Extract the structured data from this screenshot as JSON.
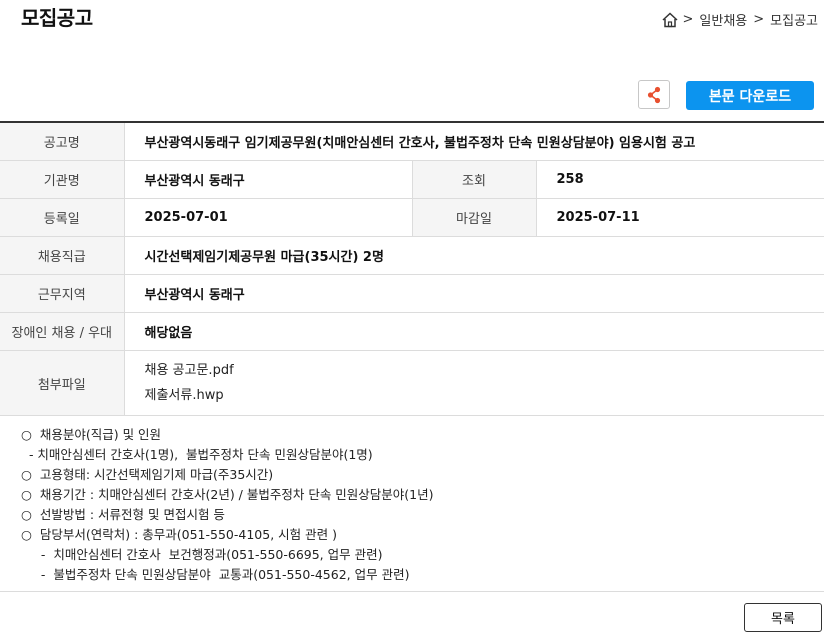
{
  "header": {
    "title": "모집공고",
    "breadcrumb": [
      {
        "label": ">"
      },
      {
        "label": "일반채용"
      },
      {
        "label": ">"
      },
      {
        "label": "모집공고"
      }
    ]
  },
  "actions": {
    "share_icon": "share-icon",
    "download_label": "본문 다운로드"
  },
  "colors": {
    "accent": "#0c94ef",
    "share_icon": "#e8502f"
  },
  "info": {
    "title_label": "공고명",
    "title_value": "부산광역시동래구 임기제공무원(치매안심센터 간호사, 불법주정차 단속 민원상담분야) 임용시험 공고",
    "org_label": "기관명",
    "org_value": "부산광역시 동래구",
    "views_label": "조회",
    "views_value": "258",
    "reg_label": "등록일",
    "reg_value": "2025-07-01",
    "deadline_label": "마감일",
    "deadline_value": "2025-07-11",
    "rank_label": "채용직급",
    "rank_value": "시간선택제임기제공무원 마급(35시간) 2명",
    "region_label": "근무지역",
    "region_value": "부산광역시 동래구",
    "disabled_label": "장애인 채용 / 우대",
    "disabled_value": "해당없음",
    "files_label": "첨부파일",
    "files": [
      "채용 공고문.pdf",
      "제출서류.hwp"
    ]
  },
  "content": {
    "lines": [
      "○  채용분야(직급) 및 인원",
      "  - 치매안심센터 간호사(1명),  불법주정차 단속 민원상담분야(1명)",
      "○  고용형태: 시간선택제임기제 마급(주35시간)",
      "○  채용기간 : 치매안심센터 간호사(2년) / 불법주정차 단속 민원상담분야(1년)",
      "○  선발방법 : 서류전형 및 면접시험 등",
      "○  담당부서(연락처) : 총무과(051-550-4105, 시험 관련 )",
      "     -  치매안심센터 간호사  보건행정과(051-550-6695, 업무 관련)",
      "     -  불법주정차 단속 민원상담분야  교통과(051-550-4562, 업무 관련)"
    ]
  },
  "footer": {
    "list_label": "목록"
  }
}
